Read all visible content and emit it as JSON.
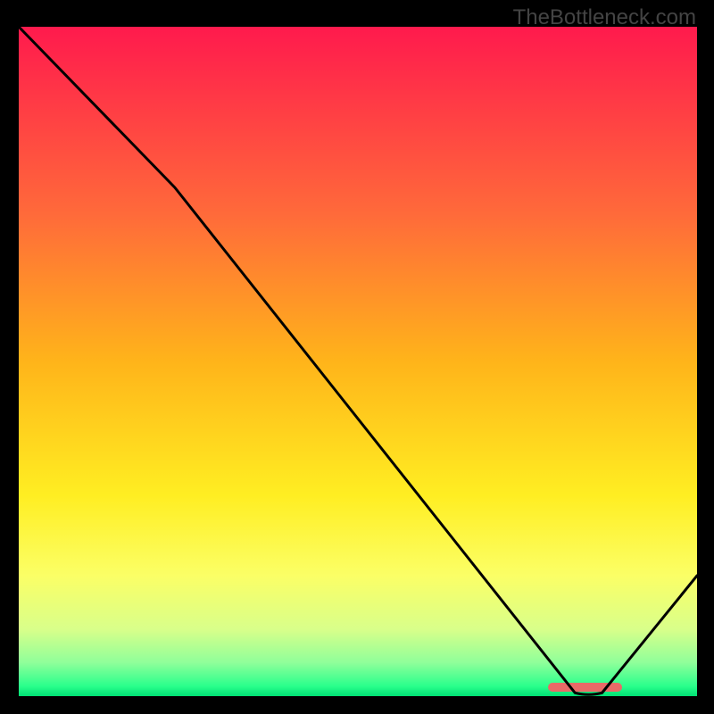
{
  "watermark": "TheBottleneck.com",
  "chart_data": {
    "type": "line",
    "title": "",
    "xlabel": "",
    "ylabel": "",
    "xlim": [
      0,
      100
    ],
    "ylim": [
      0,
      100
    ],
    "gradient_stops": [
      {
        "pos": 0,
        "color": "#ff1a4d"
      },
      {
        "pos": 28,
        "color": "#ff6a3a"
      },
      {
        "pos": 50,
        "color": "#ffb41a"
      },
      {
        "pos": 70,
        "color": "#ffee22"
      },
      {
        "pos": 82,
        "color": "#fbff66"
      },
      {
        "pos": 90,
        "color": "#d9ff8a"
      },
      {
        "pos": 95,
        "color": "#8fff9a"
      },
      {
        "pos": 98.5,
        "color": "#2aff8c"
      },
      {
        "pos": 100,
        "color": "#00e074"
      }
    ],
    "curve": [
      {
        "x": 0,
        "y": 100
      },
      {
        "x": 23,
        "y": 76
      },
      {
        "x": 82,
        "y": 0.5
      },
      {
        "x": 86,
        "y": 0.5
      },
      {
        "x": 100,
        "y": 18
      }
    ],
    "marker": {
      "x_start": 78,
      "x_end": 89,
      "y": 1.3
    }
  }
}
